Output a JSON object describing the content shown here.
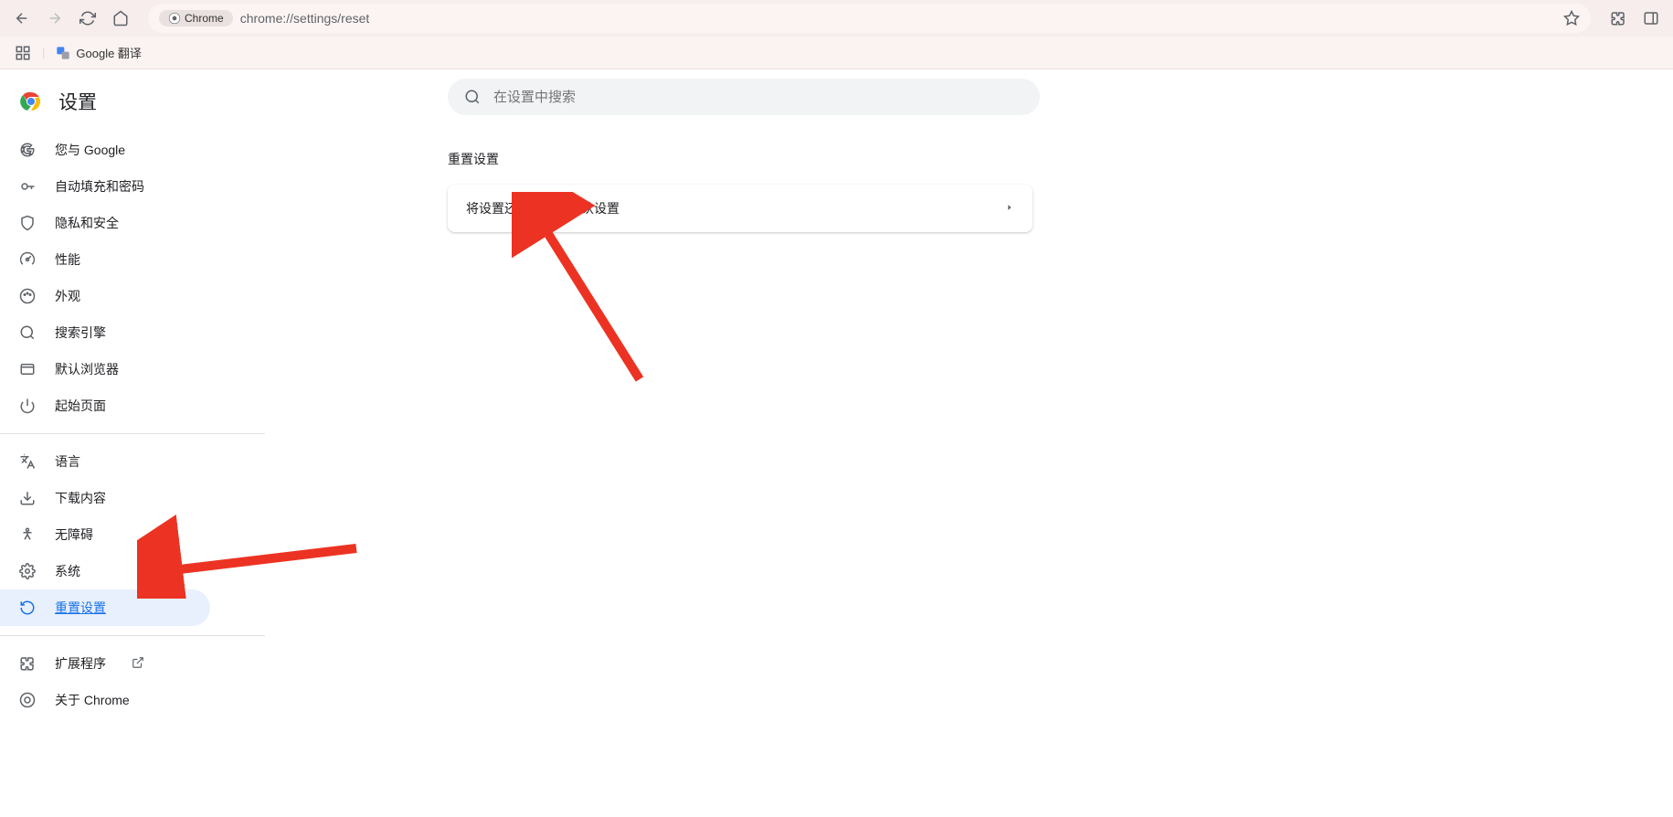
{
  "browser": {
    "url_chip_label": "Chrome",
    "url_text": "chrome://settings/reset"
  },
  "bookmarks": {
    "translate_label": "Google 翻译"
  },
  "sidebar": {
    "title": "设置",
    "items": {
      "you_google": "您与 Google",
      "autofill": "自动填充和密码",
      "privacy": "隐私和安全",
      "performance": "性能",
      "appearance": "外观",
      "search_engine": "搜索引擎",
      "default_browser": "默认浏览器",
      "startup": "起始页面",
      "languages": "语言",
      "downloads": "下载内容",
      "accessibility": "无障碍",
      "system": "系统",
      "reset": "重置设置",
      "extensions": "扩展程序",
      "about": "关于 Chrome"
    }
  },
  "main": {
    "search_placeholder": "在设置中搜索",
    "section_title": "重置设置",
    "card_label": "将设置还原为原始默认设置"
  }
}
